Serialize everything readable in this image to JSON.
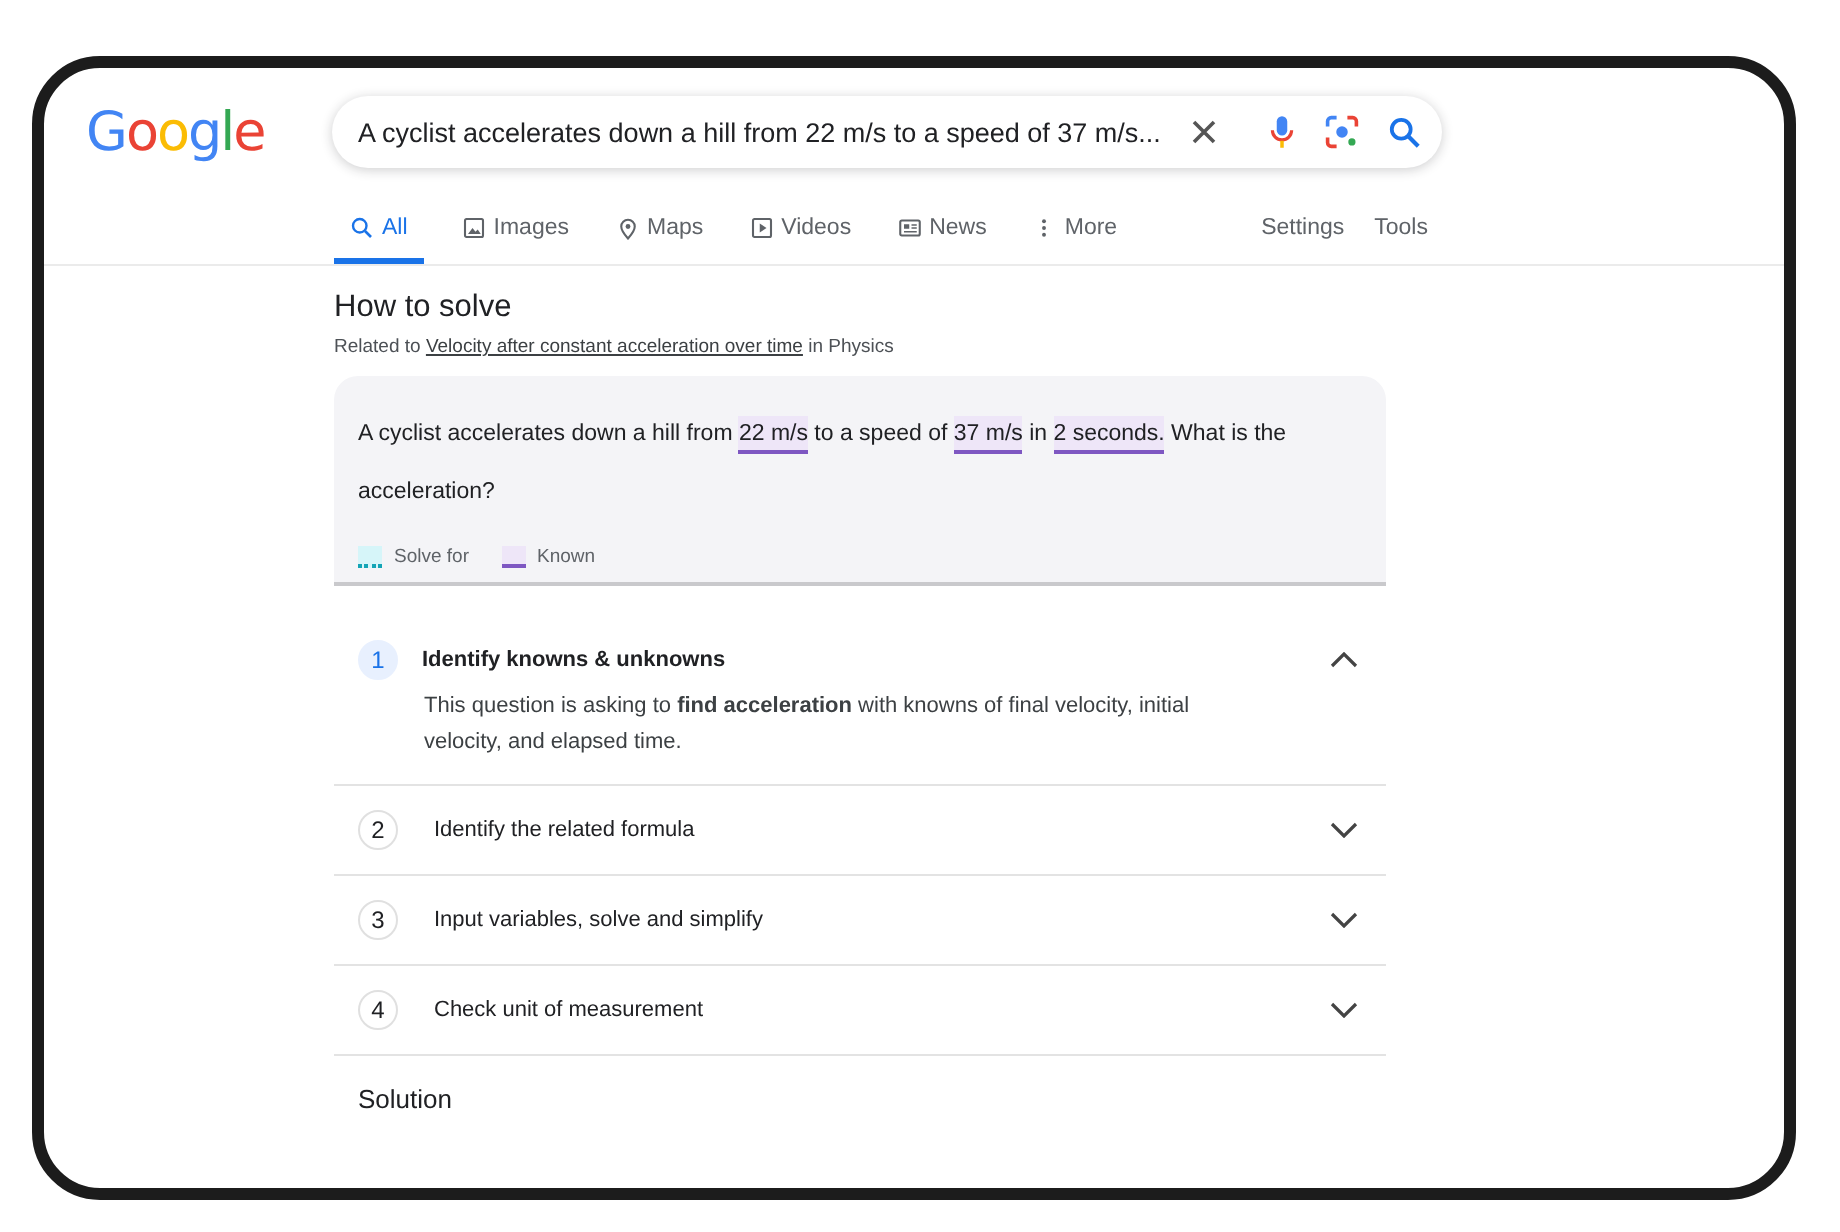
{
  "logo": "Google",
  "search": {
    "value": "A cyclist accelerates down a hill from 22 m/s to a speed of 37 m/s..."
  },
  "tabs": [
    {
      "label": "All",
      "kind": "search",
      "selected": true
    },
    {
      "label": "Images",
      "kind": "image",
      "selected": false
    },
    {
      "label": "Maps",
      "kind": "pin",
      "selected": false
    },
    {
      "label": "Videos",
      "kind": "play",
      "selected": false
    },
    {
      "label": "News",
      "kind": "news",
      "selected": false
    },
    {
      "label": "More",
      "kind": "dots",
      "selected": false
    }
  ],
  "tools": [
    "Settings",
    "Tools"
  ],
  "heading": "How to solve",
  "related": {
    "prefix": "Related to",
    "link": "Velocity after constant acceleration over time",
    "suffix": "in Physics"
  },
  "question": [
    {
      "text": "A cyclist accelerates down a hill from ",
      "kind": "plain"
    },
    {
      "text": "22 m/s",
      "kind": "known"
    },
    {
      "text": " to a speed of ",
      "kind": "plain"
    },
    {
      "text": "37 m/s",
      "kind": "known"
    },
    {
      "text": " in ",
      "kind": "plain"
    },
    {
      "text": "2 seconds.",
      "kind": "known"
    },
    {
      "text": " What is the acceleration?",
      "kind": "plain"
    }
  ],
  "legend": [
    {
      "label": "Solve for",
      "kind": "solve"
    },
    {
      "label": "Known",
      "kind": "known"
    }
  ],
  "steps": [
    {
      "number": "1",
      "title": "Identify knowns & unknowns",
      "expanded": true,
      "body": "This question is asking to **find acceleration** with knowns of final velocity, initial velocity, and elapsed time."
    },
    {
      "number": "2",
      "title": "Identify the related formula",
      "expanded": false
    },
    {
      "number": "3",
      "title": "Input variables, solve and simplify",
      "expanded": false
    },
    {
      "number": "4",
      "title": "Check unit of measurement",
      "expanded": false
    }
  ],
  "solution_heading": "Solution"
}
